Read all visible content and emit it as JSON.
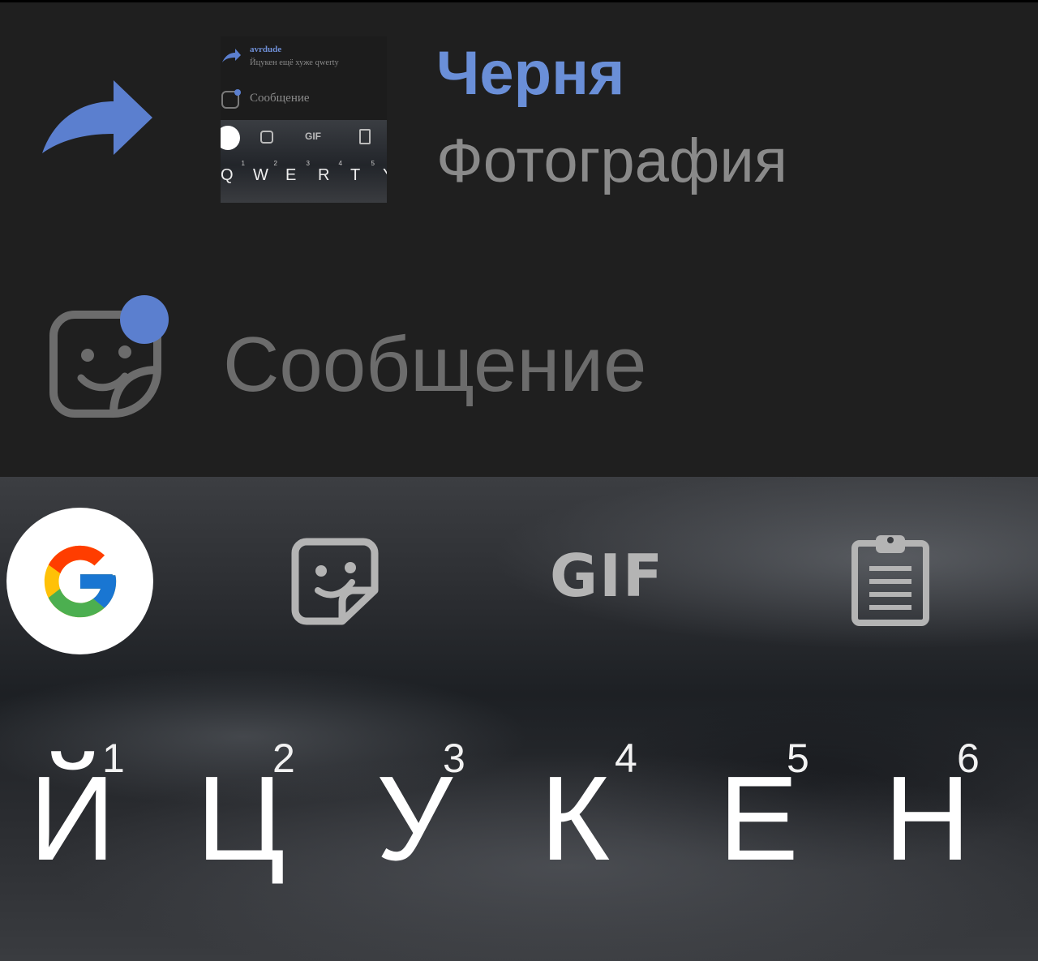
{
  "reply_preview": {
    "name": "Черня",
    "subtitle": "Фотография",
    "thumbnail": {
      "name": "avrdude",
      "preview_text": "Йцукен ещё хуже qwerty",
      "message_placeholder": "Сообщение",
      "gif_label": "GIF",
      "keys": [
        {
          "letter": "Q",
          "hint": "1"
        },
        {
          "letter": "W",
          "hint": "2"
        },
        {
          "letter": "E",
          "hint": "3"
        },
        {
          "letter": "R",
          "hint": "4"
        },
        {
          "letter": "T",
          "hint": "5"
        },
        {
          "letter": "Y",
          "hint": ""
        }
      ]
    }
  },
  "composer": {
    "placeholder": "Сообщение",
    "sticker_icon": "sticker-icon",
    "has_badge": true
  },
  "keyboard": {
    "toolbar": {
      "google_icon": "google-icon",
      "sticker_icon": "sticker-icon",
      "gif_label": "GIF",
      "clipboard_icon": "clipboard-icon"
    },
    "row1": [
      {
        "letter": "Й",
        "hint": "1"
      },
      {
        "letter": "Ц",
        "hint": "2"
      },
      {
        "letter": "У",
        "hint": "3"
      },
      {
        "letter": "К",
        "hint": "4"
      },
      {
        "letter": "Е",
        "hint": "5"
      },
      {
        "letter": "Н",
        "hint": "6"
      }
    ]
  },
  "colors": {
    "accent": "#6a8fd8",
    "background": "#1f1f1f",
    "muted_text": "#8a8a8a"
  }
}
